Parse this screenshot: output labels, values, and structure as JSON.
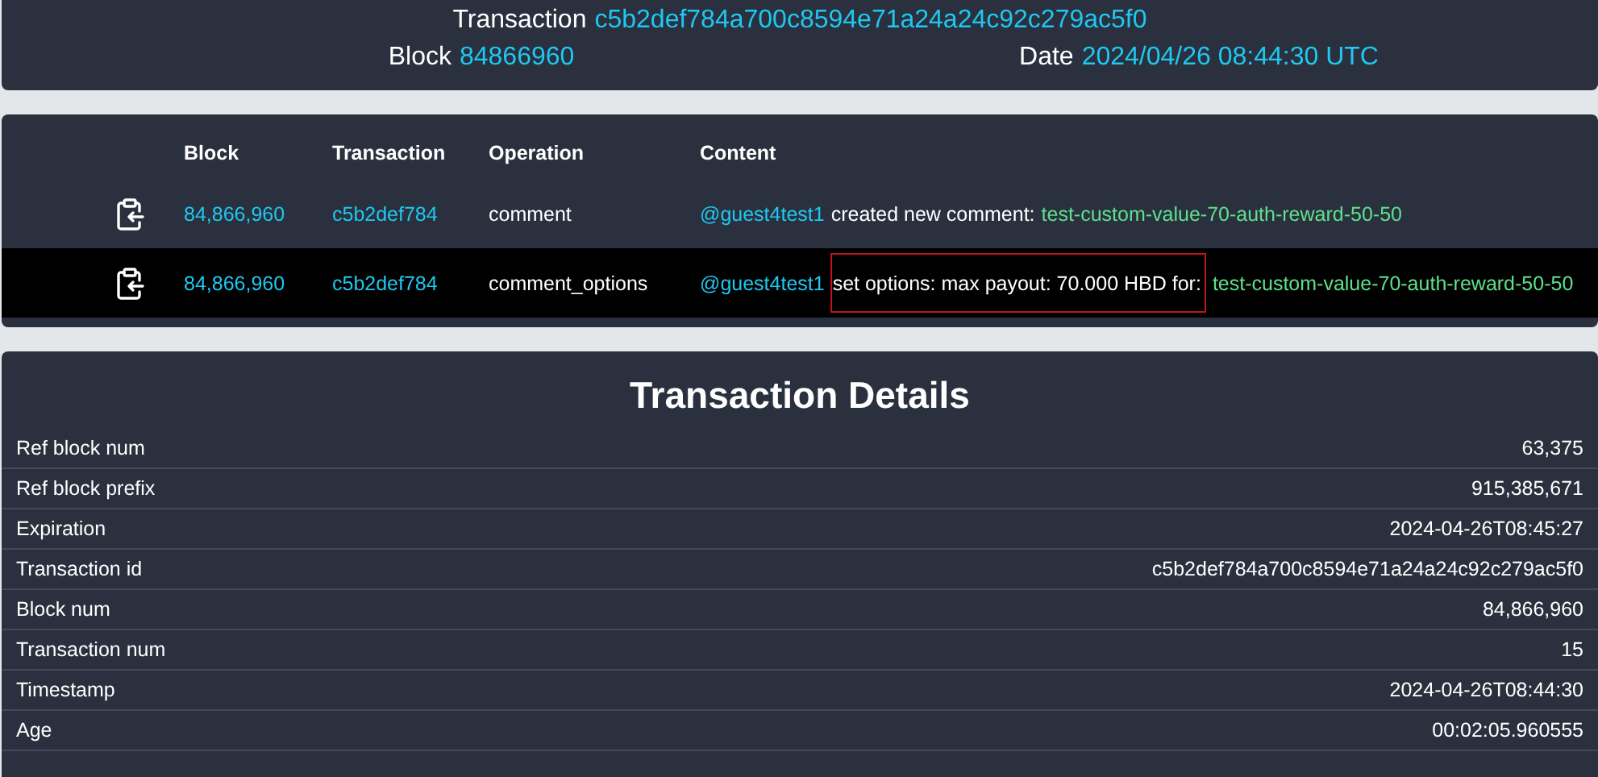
{
  "header": {
    "transaction_label": "Transaction",
    "transaction_id": "c5b2def784a700c8594e71a24a24c92c279ac5f0",
    "block_label": "Block",
    "block": "84866960",
    "date_label": "Date",
    "date": "2024/04/26 08:44:30 UTC"
  },
  "operations": {
    "columns": [
      "Block",
      "Transaction",
      "Operation",
      "Content"
    ],
    "rows": [
      {
        "selected": false,
        "block": "84,866,960",
        "transaction": "c5b2def784",
        "operation": "comment",
        "user": "@guest4test1",
        "action": "created new comment:",
        "highlighted": false,
        "permlink": "test-custom-value-70-auth-reward-50-50"
      },
      {
        "selected": true,
        "block": "84,866,960",
        "transaction": "c5b2def784",
        "operation": "comment_options",
        "user": "@guest4test1",
        "action": "set options: max payout: 70.000 HBD for:",
        "highlighted": true,
        "permlink": "test-custom-value-70-auth-reward-50-50"
      }
    ]
  },
  "details": {
    "title": "Transaction Details",
    "rows": [
      {
        "label": "Ref block num",
        "value": "63,375"
      },
      {
        "label": "Ref block prefix",
        "value": "915,385,671"
      },
      {
        "label": "Expiration",
        "value": "2024-04-26T08:45:27"
      },
      {
        "label": "Transaction id",
        "value": "c5b2def784a700c8594e71a24a24c92c279ac5f0"
      },
      {
        "label": "Block num",
        "value": "84,866,960"
      },
      {
        "label": "Transaction num",
        "value": "15"
      },
      {
        "label": "Timestamp",
        "value": "2024-04-26T08:44:30"
      },
      {
        "label": "Age",
        "value": "00:02:05.960555"
      }
    ]
  }
}
